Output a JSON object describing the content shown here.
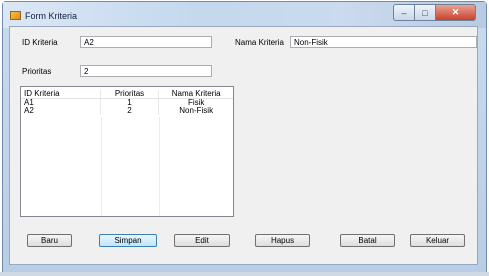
{
  "window": {
    "title": "Form Kriteria",
    "minimize": "–",
    "maximize": "□",
    "close": "✕"
  },
  "form": {
    "id_label": "ID Kriteria",
    "id_value": "A2",
    "nama_label": "Nama Kriteria",
    "nama_value": "Non-Fisik",
    "prioritas_label": "Prioritas",
    "prioritas_value": "2"
  },
  "grid": {
    "columns": [
      "ID Kriteria",
      "Prioritas",
      "Nama Kriteria"
    ],
    "rows": [
      [
        "A1",
        "1",
        "Fisik"
      ],
      [
        "A2",
        "2",
        "Non-Fisik"
      ]
    ]
  },
  "buttons": {
    "baru": "Baru",
    "simpan": "Simpan",
    "edit": "Edit",
    "hapus": "Hapus",
    "batal": "Batal",
    "keluar": "Keluar"
  }
}
